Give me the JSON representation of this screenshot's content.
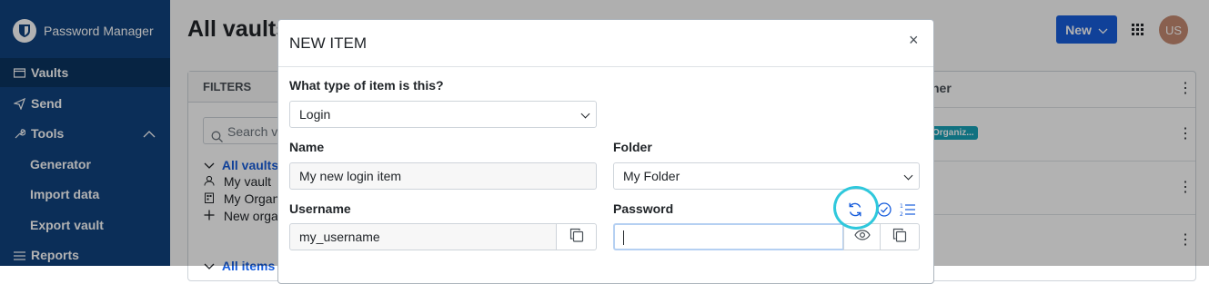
{
  "app": {
    "name": "Password Manager"
  },
  "sidebar": {
    "items": [
      {
        "label": "Vaults",
        "icon": "vault-icon",
        "active": true
      },
      {
        "label": "Send",
        "icon": "send-icon"
      },
      {
        "label": "Tools",
        "icon": "wrench-icon",
        "expanded": true
      }
    ],
    "tools_sub": [
      "Generator",
      "Import data",
      "Export vault"
    ],
    "reports": {
      "label": "Reports",
      "icon": "reports-icon"
    }
  },
  "page": {
    "title": "All vaults",
    "new_button": "New",
    "avatar_initials": "US"
  },
  "filters": {
    "title": "FILTERS",
    "search_placeholder": "Search va",
    "tree": [
      "All vaults",
      "My vault",
      "My Organ",
      "New orga"
    ],
    "all_items": "All items"
  },
  "table": {
    "owner_header": "ner",
    "org_badge": "Organiz..."
  },
  "modal": {
    "title": "NEW ITEM",
    "close": "×",
    "type_label": "What type of item is this?",
    "type_value": "Login",
    "name_label": "Name",
    "name_value": "My new login item",
    "folder_label": "Folder",
    "folder_value": "My Folder",
    "username_label": "Username",
    "username_value": "my_username",
    "password_label": "Password",
    "password_value": ""
  },
  "colors": {
    "sidebar": "#10427f",
    "accent": "#175ddc",
    "highlight_ring": "#2fc8dc",
    "badge": "#17a2b8"
  }
}
